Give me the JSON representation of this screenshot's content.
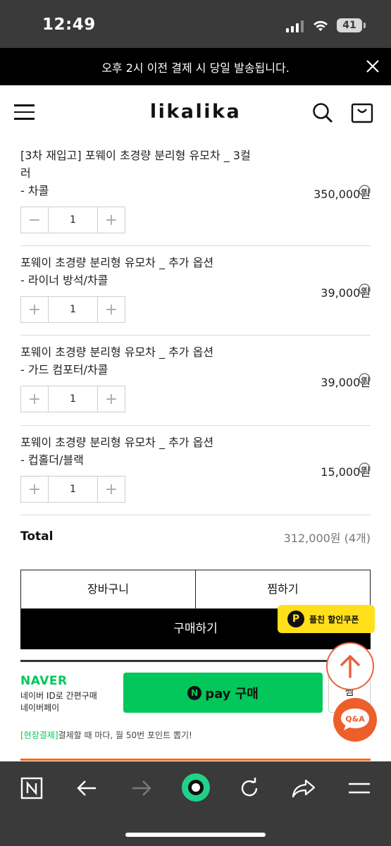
{
  "status": {
    "time": "12:49",
    "battery": "41"
  },
  "banner": {
    "text": "오후 2시 이전 결제 시 당일 발송됩니다."
  },
  "header": {
    "logo": "likalika"
  },
  "items": [
    {
      "title": "[3차 재입고] 포웨이 초경량 분리형 유모차 _ 3컬러",
      "option": "- 차콜",
      "price": "350,000원",
      "qty": "1"
    },
    {
      "title": "포웨이 초경량 분리형 유모차 _ 추가 옵션",
      "option": "- 라이너 방석/차콜",
      "price": "39,000원",
      "qty": "1"
    },
    {
      "title": "포웨이 초경량 분리형 유모차 _ 추가 옵션",
      "option": "- 가드 컴포터/차콜",
      "price": "39,000원",
      "qty": "1"
    },
    {
      "title": "포웨이 초경량 분리형 유모차 _ 추가 옵션",
      "option": "- 컵홀더/블랙",
      "price": "15,000원",
      "qty": "1"
    }
  ],
  "total": {
    "label": "Total",
    "value": "312,000원 (4개)"
  },
  "buttons": {
    "cart": "장바구니",
    "wish": "찜하기",
    "buy": "구매하기"
  },
  "coupon": {
    "badge": "P",
    "text": "플친 할인쿠폰"
  },
  "naver": {
    "logo": "NAVER",
    "desc_line1": "네이버 ID로 간편구매",
    "desc_line2": "네이버페이",
    "pay_n": "N",
    "pay_label": "pay 구매",
    "zzim_label": "찜",
    "note_highlight": "[현장결제]",
    "note_text": "결제할 때 마다, 월 50번 포인트 뽑기!"
  },
  "qa": {
    "label": "Q&A"
  },
  "colors": {
    "naver_green": "#03c75a",
    "coupon_yellow": "#ffe01b",
    "accent_orange": "#ec5f2a"
  }
}
